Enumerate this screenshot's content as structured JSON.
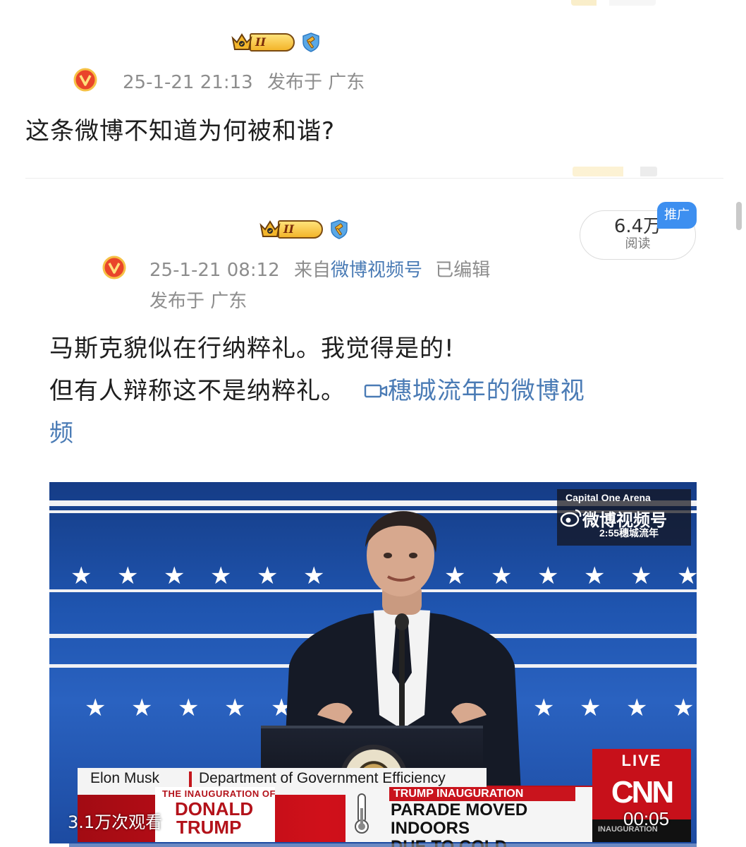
{
  "post1": {
    "badge_level": "II",
    "timestamp": "25-1-21 21:13",
    "published_in": "发布于 广东",
    "text": "这条微博不知道为何被和谐?"
  },
  "post2": {
    "badge_level": "II",
    "timestamp": "25-1-21 08:12",
    "source_prefix": "来自",
    "source_link": "微博视频号",
    "edited": "已编辑",
    "published_in": "发布于 广东",
    "text_line1": "马斯克貌似在行纳粹礼。我觉得是的!",
    "text_line2": "但有人辩称这不是纳粹礼。",
    "video_link_line1": "穗城流年的微博视",
    "video_link_line2": "频",
    "read_count": "6.4万",
    "read_label": "阅读",
    "promo_tag": "推广"
  },
  "video": {
    "arena": "Capital One Arena",
    "watermark": "微博视频号",
    "watermark_time": "2:55",
    "watermark_user": "穗城流年",
    "lower_third": {
      "name": "Elon Musk",
      "title": "Department of Government Efficiency",
      "inauguration_small": "THE INAUGURATION OF",
      "donald": "DONALD",
      "trump": "TRUMP",
      "trump_inauguration": "TRUMP INAUGURATION",
      "headline_line1": "PARADE MOVED INDOORS",
      "headline_line2": "DUE TO COLD"
    },
    "live": "LIVE",
    "network": "CNN",
    "network_foot": "INAUGURATION",
    "views": "3.1万次观看",
    "duration": "00:05",
    "progress": 0.03
  },
  "colors": {
    "link": "#4a7bb5",
    "meta": "#8d8d8d",
    "promo": "#3d8ff0",
    "cnn_red": "#c7101a"
  }
}
